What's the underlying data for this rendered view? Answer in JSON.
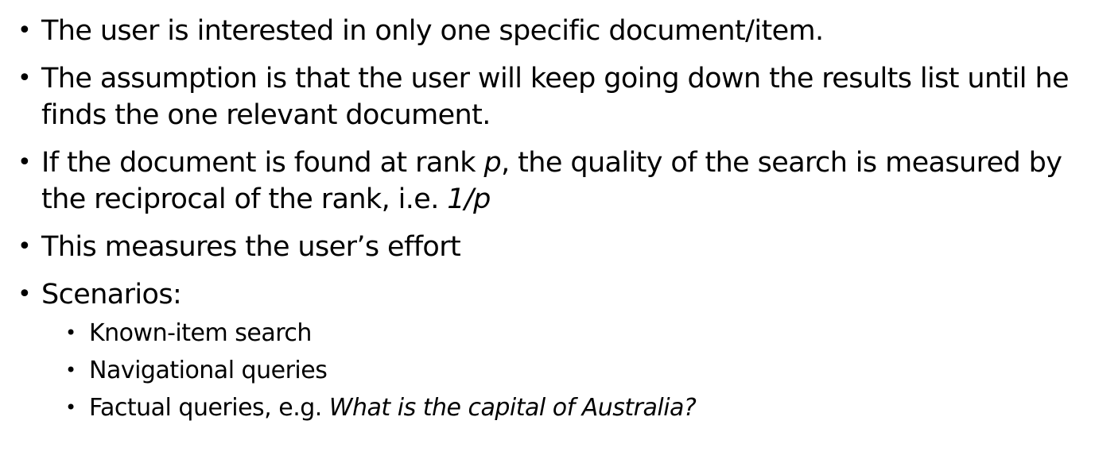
{
  "bullets": [
    {
      "text": "The user is interested in only one specific document/item."
    },
    {
      "text": "The assumption is that the user will keep going down the results list until he finds the one relevant document."
    },
    {
      "text_1": "If the document is found at rank ",
      "italic_1": "p",
      "text_2": ", the quality of the search is measured by the reciprocal of the rank, i.e. ",
      "italic_2": "1/p"
    },
    {
      "text": "This measures the user’s effort"
    },
    {
      "text": "Scenarios:",
      "sub": [
        {
          "text": "Known-item search"
        },
        {
          "text": "Navigational queries"
        },
        {
          "text": "Factual queries, e.g. ",
          "italic": "What is the capital of Australia?"
        }
      ]
    }
  ],
  "bullet_symbol": "•"
}
